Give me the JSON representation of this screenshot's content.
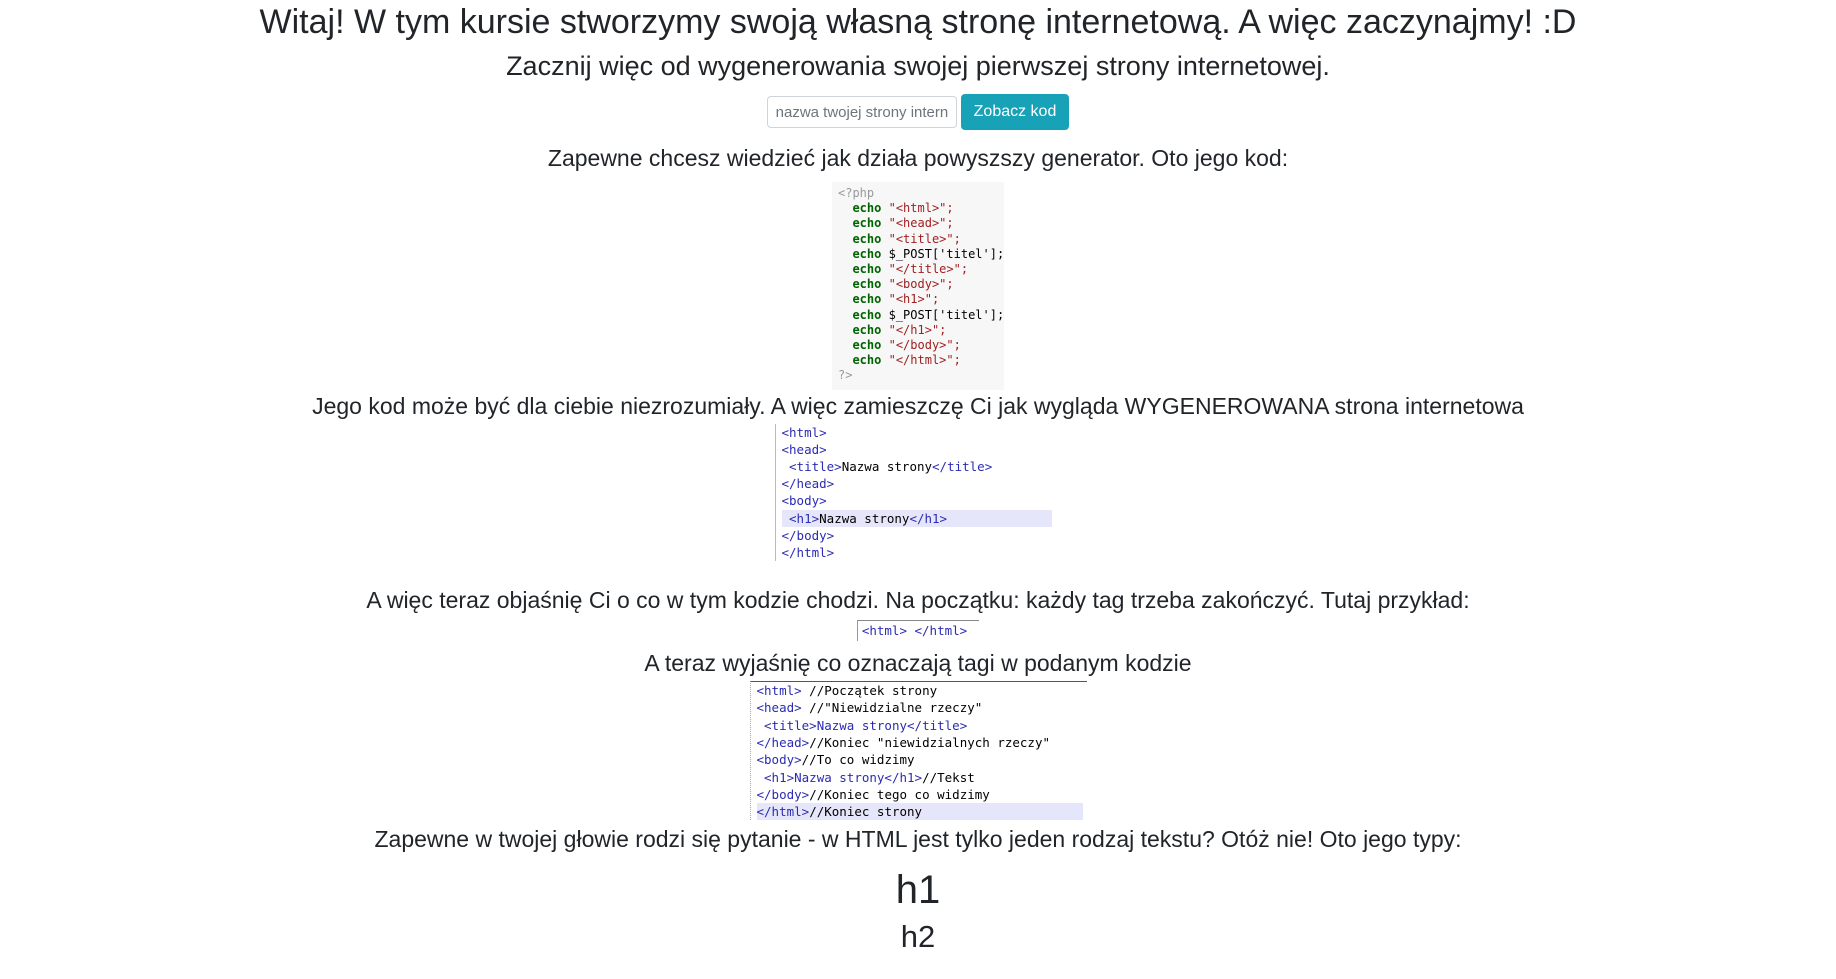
{
  "header": {
    "title": "Witaj! W tym kursie stworzymy swoją własną stronę internetową. A więc zaczynajmy! :D",
    "subtitle": "Zacznij więc od wygenerowania swojej pierwszej strony internetowej."
  },
  "form": {
    "placeholder": "nazwa twojej strony internetowej",
    "button_label": "Zobacz kod"
  },
  "sections": {
    "generator_intro": "Zapewne chcesz wiedzieć jak działa powyszszy generator. Oto jego kod:",
    "generated_intro": "Jego kod może być dla ciebie niezrozumiały. A więc zamieszczę Ci jak wygląda WYGENEROWANA strona internetowa",
    "closing_intro": "A więc teraz objaśnię Ci o co w tym kodzie chodzi. Na początku: każdy tag trzeba zakończyć. Tutaj przykład:",
    "tags_intro": "A teraz wyjaśnię co oznaczają tagi w podanym kodzie",
    "text_types_intro": "Zapewne w twojej głowie rodzi się pytanie - w HTML jest tylko jeden rodzaj tekstu? Otóż nie! Oto jego typy:"
  },
  "code_php": {
    "open": "<?php",
    "lines": [
      [
        "echo",
        "\"<html>\";"
      ],
      [
        "echo",
        "\"<head>\";"
      ],
      [
        "echo",
        "\"<title>\";"
      ],
      [
        "echo",
        "$_POST['titel'];"
      ],
      [
        "echo",
        "\"</title>\";"
      ],
      [
        "echo",
        "\"<body>\";"
      ],
      [
        "echo",
        "\"<h1>\";"
      ],
      [
        "echo",
        "$_POST['titel'];"
      ],
      [
        "echo",
        "\"</h1>\";"
      ],
      [
        "echo",
        "\"</body>\";"
      ],
      [
        "echo",
        "\"</html>\";"
      ]
    ],
    "close": "?>"
  },
  "code_generated": {
    "lines": [
      {
        "tag_open": "<html>",
        "text": "",
        "tag_close": ""
      },
      {
        "tag_open": "<head>",
        "text": "",
        "tag_close": ""
      },
      {
        "tag_open": " <title>",
        "text": "Nazwa strony",
        "tag_close": "</title>"
      },
      {
        "tag_open": "</head>",
        "text": "",
        "tag_close": ""
      },
      {
        "tag_open": "<body>",
        "text": "",
        "tag_close": ""
      },
      {
        "tag_open": " <h1>",
        "text": "Nazwa strony",
        "tag_close": "</h1>"
      },
      {
        "tag_open": "</body>",
        "text": "",
        "tag_close": ""
      },
      {
        "tag_open": "</html>",
        "text": "",
        "tag_close": ""
      }
    ]
  },
  "code_example": "<html> </html>",
  "code_commented": {
    "lines": [
      {
        "tag": "<html>",
        "comment": " //Początek strony"
      },
      {
        "tag": "<head>",
        "comment": " //\"Niewidzialne rzeczy\""
      },
      {
        "tag": " <title>Nazwa strony</title>",
        "comment": ""
      },
      {
        "tag": "</head>",
        "comment": "//Koniec \"niewidzialnych rzeczy\""
      },
      {
        "tag": "<body>",
        "comment": "//To co widzimy"
      },
      {
        "tag": " <h1>Nazwa strony</h1>",
        "comment": "//Tekst"
      },
      {
        "tag": "</body>",
        "comment": "//Koniec tego co widzimy"
      },
      {
        "tag": "</html>",
        "comment": "//Koniec strony"
      }
    ]
  },
  "text_types": {
    "h1": "h1",
    "h2": "h2"
  }
}
